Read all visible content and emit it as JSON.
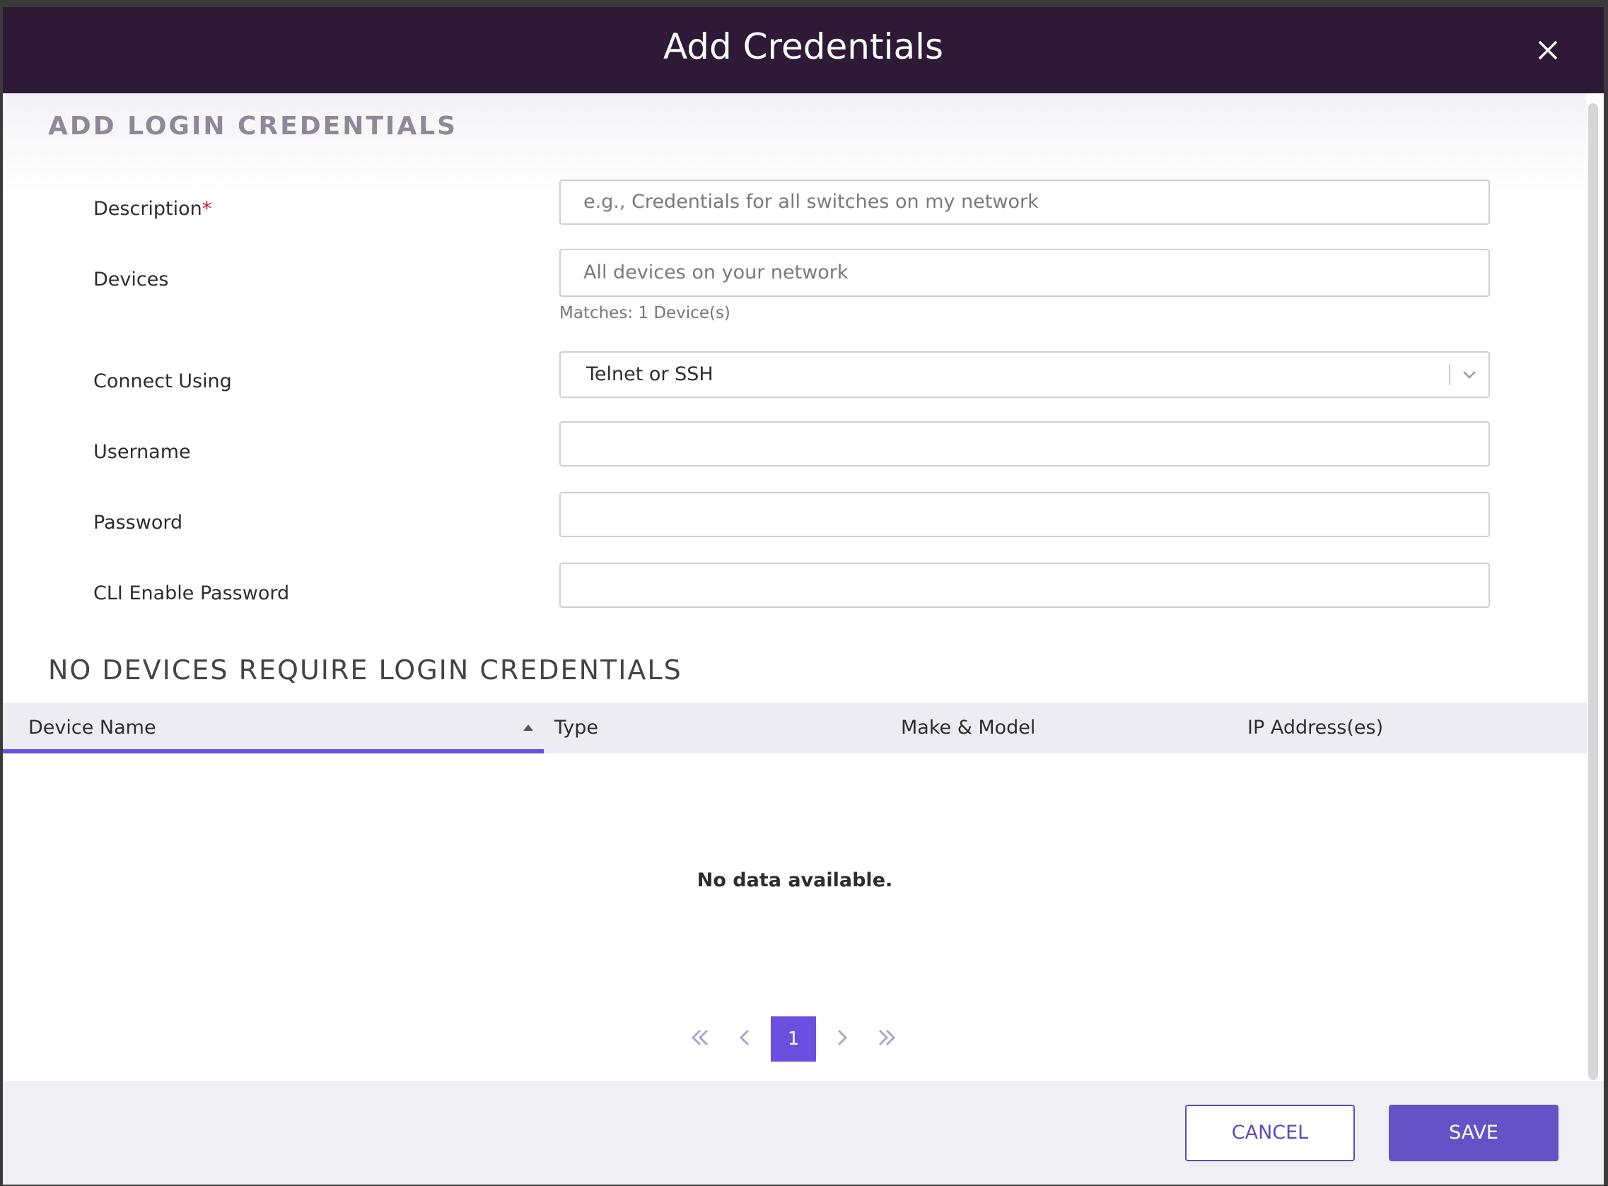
{
  "dialog": {
    "title": "Add Credentials"
  },
  "login_section": {
    "title": "ADD LOGIN CREDENTIALS",
    "fields": {
      "description": {
        "label": "Description",
        "required_mark": "*",
        "placeholder": "e.g., Credentials for all switches on my network",
        "value": ""
      },
      "devices": {
        "label": "Devices",
        "placeholder": "All devices on your network",
        "value": "",
        "matches_text": "Matches: 1 Device(s)"
      },
      "connect_using": {
        "label": "Connect Using",
        "selected": "Telnet or SSH"
      },
      "username": {
        "label": "Username",
        "value": ""
      },
      "password": {
        "label": "Password",
        "value": ""
      },
      "cli_enable_password": {
        "label": "CLI Enable Password",
        "value": ""
      }
    }
  },
  "devices_section": {
    "title": "NO DEVICES REQUIRE LOGIN CREDENTIALS",
    "columns": [
      "Device Name",
      "Type",
      "Make & Model",
      "IP Address(es)"
    ],
    "sorted_column": "Device Name",
    "sort_direction": "ascending",
    "rows": [],
    "empty_message": "No data available.",
    "pagination": {
      "current_page": "1"
    }
  },
  "footer": {
    "cancel_label": "CANCEL",
    "save_label": "SAVE"
  },
  "colors": {
    "header_bg": "#2e1a36",
    "accent": "#6a4fe0",
    "primary_button": "#6552c6",
    "required": "#d0103a"
  },
  "icons": {
    "close": "close-icon",
    "select": "chevron-down-icon",
    "sort": "sort-ascending-icon",
    "pager": [
      "first-page-icon",
      "previous-page-icon",
      "next-page-icon",
      "last-page-icon"
    ]
  }
}
